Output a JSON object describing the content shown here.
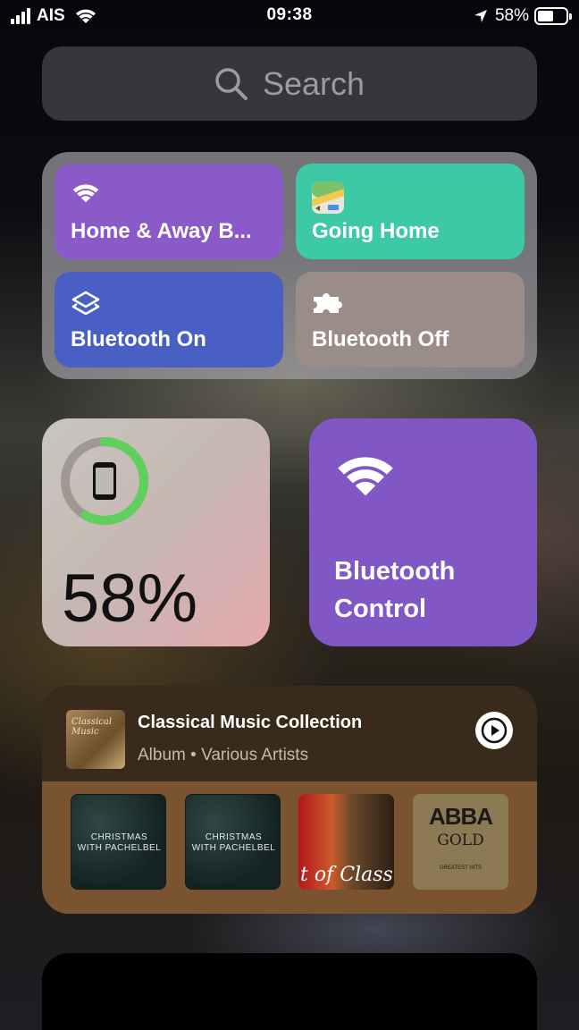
{
  "status_bar": {
    "carrier": "AIS",
    "time": "09:38",
    "battery_percent": "58%",
    "battery_level": 0.58
  },
  "search": {
    "placeholder": "Search"
  },
  "shortcuts": [
    {
      "label": "Home & Away B...",
      "icon": "wifi-icon",
      "color": "#8a5bc8"
    },
    {
      "label": "Going Home",
      "icon": "maps-app-icon",
      "color": "#3ec9a6"
    },
    {
      "label": "Bluetooth On",
      "icon": "layers-icon",
      "color": "#4a5fc4"
    },
    {
      "label": "Bluetooth Off",
      "icon": "puzzle-icon",
      "color": "#9a8d88"
    }
  ],
  "battery_widget": {
    "percent_label": "58%",
    "level": 0.58,
    "ring_color": "#5fd05c",
    "icon": "phone-icon"
  },
  "bluetooth_widget": {
    "label": "Bluetooth Control",
    "icon": "wifi-icon",
    "color": "#8157c6"
  },
  "music_widget": {
    "title": "Classical Music Collection",
    "subtitle": "Album • Various Artists",
    "play_icon": "play-icon",
    "album_art_text": "Classical Music",
    "tiles": [
      {
        "text": "CHRISTMAS\nWITH PACHELBEL"
      },
      {
        "text": "CHRISTMAS\nWITH PACHELBEL"
      },
      {
        "text": "t of Classic"
      },
      {
        "title": "ABBA",
        "subtitle": "GOLD",
        "small": "GREATEST HITS"
      }
    ]
  }
}
